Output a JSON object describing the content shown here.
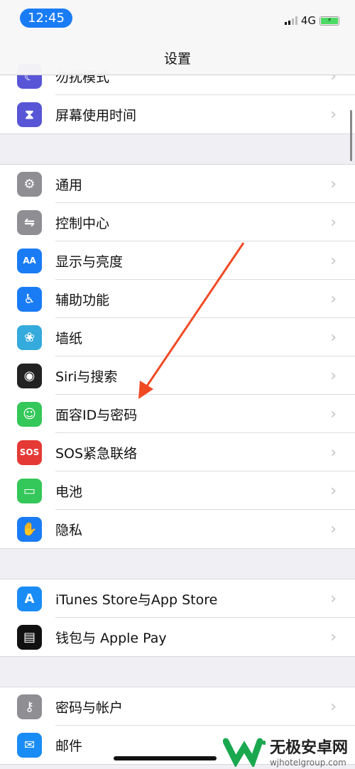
{
  "status_bar": {
    "time": "12:45",
    "network": "4G",
    "battery_charging": true
  },
  "nav": {
    "title": "设置"
  },
  "groups": [
    [
      {
        "label": "勿扰模式",
        "icon": "moon-icon",
        "color": "#5856d6"
      },
      {
        "label": "屏幕使用时间",
        "icon": "hourglass-icon",
        "color": "#5856d6"
      }
    ],
    [
      {
        "label": "通用",
        "icon": "gear-icon",
        "color": "#8e8e93"
      },
      {
        "label": "控制中心",
        "icon": "toggles-icon",
        "color": "#8e8e93"
      },
      {
        "label": "显示与亮度",
        "icon": "text-size-icon",
        "color": "#1a7cf5"
      },
      {
        "label": "辅助功能",
        "icon": "accessibility-icon",
        "color": "#1a7cf5"
      },
      {
        "label": "墙纸",
        "icon": "flower-icon",
        "color": "#35aadc"
      },
      {
        "label": "Siri与搜索",
        "icon": "siri-icon",
        "color": "#222"
      },
      {
        "label": "面容ID与密码",
        "icon": "face-id-icon",
        "color": "#34c759"
      },
      {
        "label": "SOS紧急联络",
        "icon": "sos-icon",
        "color": "#e53935"
      },
      {
        "label": "电池",
        "icon": "battery-icon",
        "color": "#34c759"
      },
      {
        "label": "隐私",
        "icon": "hand-icon",
        "color": "#1a7cf5"
      }
    ],
    [
      {
        "label": "iTunes Store与App Store",
        "icon": "app-store-icon",
        "color": "#1a8cf5"
      },
      {
        "label": "钱包与 Apple Pay",
        "icon": "wallet-icon",
        "color": "#111"
      }
    ],
    [
      {
        "label": "密码与帐户",
        "icon": "key-icon",
        "color": "#8e8e93"
      },
      {
        "label": "邮件",
        "icon": "mail-icon",
        "color": "#1a8cf5"
      }
    ]
  ],
  "icon_glyphs": {
    "moon-icon": "☾",
    "hourglass-icon": "⧗",
    "gear-icon": "⚙",
    "toggles-icon": "⇋",
    "text-size-icon": "AA",
    "accessibility-icon": "♿",
    "flower-icon": "❀",
    "siri-icon": "◉",
    "face-id-icon": "☺",
    "sos-icon": "SOS",
    "battery-icon": "▭",
    "hand-icon": "✋",
    "app-store-icon": "A",
    "wallet-icon": "▤",
    "key-icon": "⚷",
    "mail-icon": "✉"
  },
  "annotation_color": "#f04a23",
  "watermark": {
    "name": "无极安卓网",
    "url": "wjhotelgroup.com"
  }
}
